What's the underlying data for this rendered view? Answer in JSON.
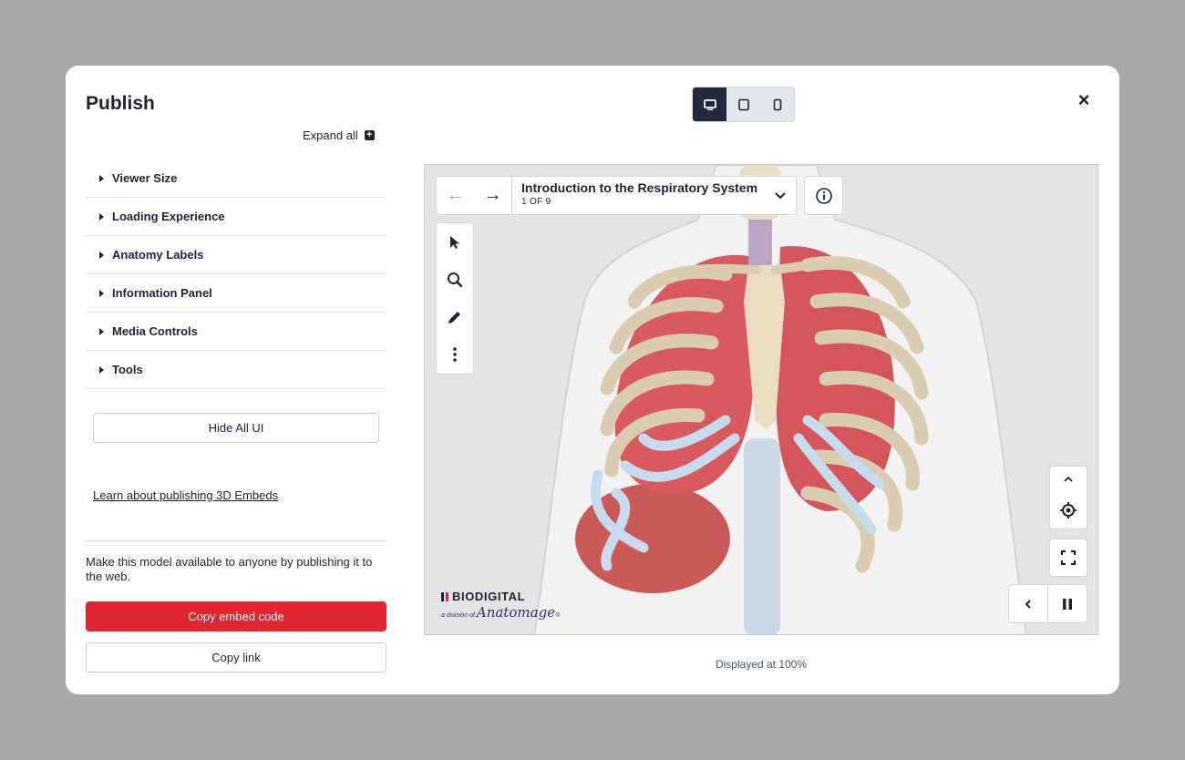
{
  "modal": {
    "title": "Publish",
    "close_glyph": "×"
  },
  "device_toggle": {
    "options": [
      "desktop-icon",
      "tablet-icon",
      "phone-icon"
    ],
    "selected": "desktop-icon"
  },
  "sidebar": {
    "expand_all": "Expand all",
    "expand_icon_glyph": "+",
    "sections": [
      "Viewer Size",
      "Loading Experience",
      "Anatomy Labels",
      "Information Panel",
      "Media Controls",
      "Tools"
    ],
    "hide_all_ui": "Hide All UI",
    "learn_link": "Learn about publishing 3D Embeds",
    "publish_description": "Make this model available to anyone by publishing it to the web.",
    "copy_embed": "Copy embed code",
    "copy_link": "Copy link"
  },
  "viewer": {
    "tour_title": "Introduction to the Respiratory System",
    "tour_count": "1 OF 9",
    "brand_name": "BIODIGITAL",
    "brand_sub_small": "a division of",
    "brand_sub_name": "Anatomage",
    "brand_mark": "®"
  },
  "colors": {
    "accent": "#e0262f",
    "dark": "#1f2a3c",
    "backdrop": "#a9a9a9"
  },
  "footer": {
    "displayed": "Displayed at 100%"
  }
}
